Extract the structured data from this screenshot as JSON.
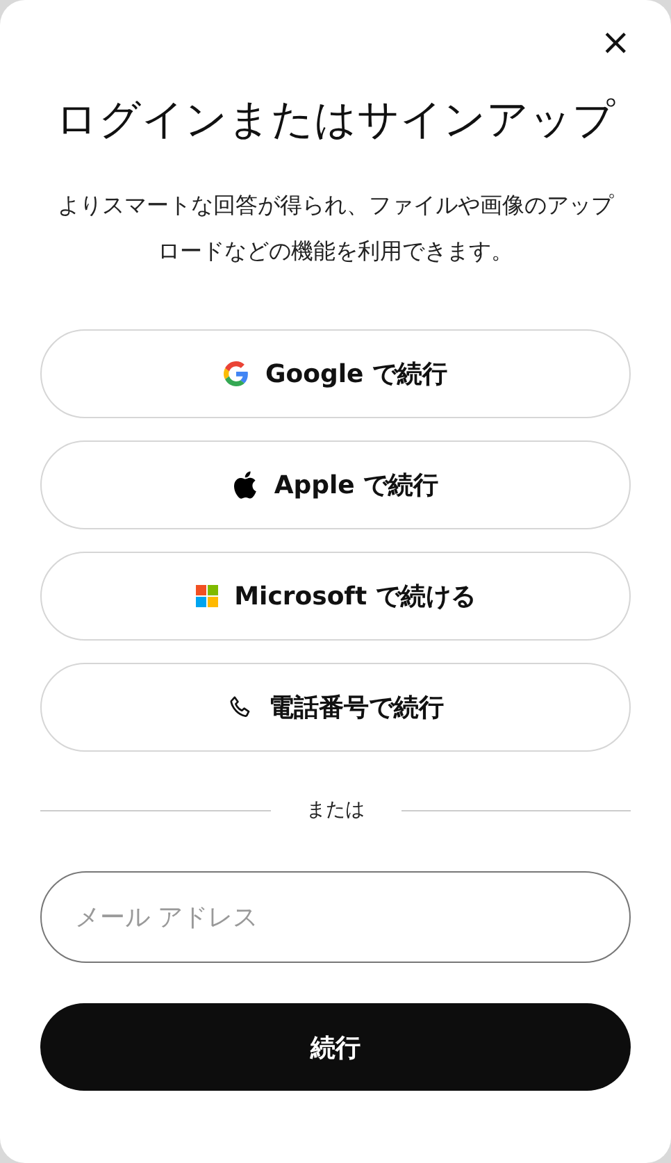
{
  "dialog": {
    "close": "×",
    "title": "ログインまたはサインアップ",
    "subtitle": "よりスマートな回答が得られ、ファイルや画像のアップロードなどの機能を利用できます。"
  },
  "providers": [
    {
      "kind": "google",
      "label": "Google で続行"
    },
    {
      "kind": "apple",
      "label": "Apple で続行"
    },
    {
      "kind": "microsoft",
      "label": "Microsoft で続ける"
    },
    {
      "kind": "phone",
      "label": "電話番号で続行"
    }
  ],
  "divider": "または",
  "email": {
    "placeholder": "メール アドレス"
  },
  "submit": "続行"
}
